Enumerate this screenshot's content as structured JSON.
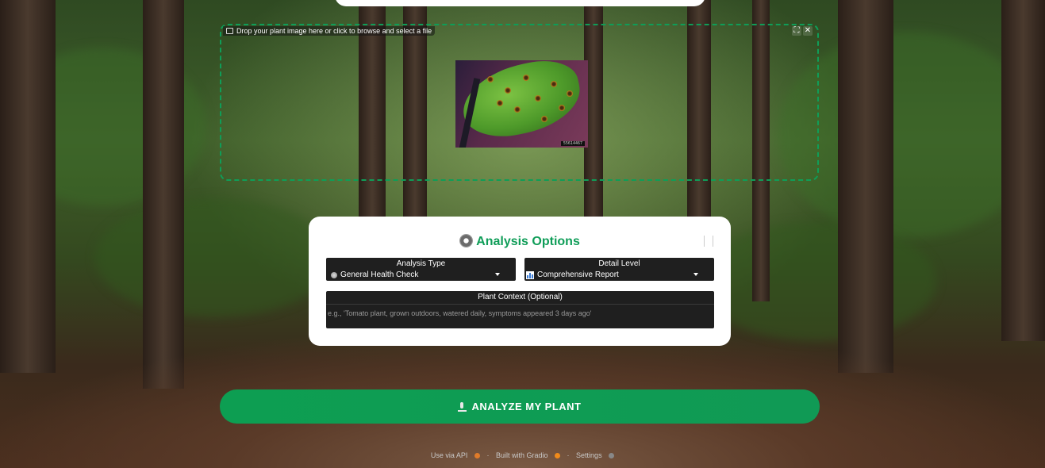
{
  "upload": {
    "label": "Drop your plant image here or click to browse and select a file",
    "image_tag": "55614467"
  },
  "options": {
    "title": "Analysis Options",
    "analysis_type": {
      "label": "Analysis Type",
      "value": "General Health Check"
    },
    "detail_level": {
      "label": "Detail Level",
      "value": "Comprehensive Report"
    },
    "context": {
      "label": "Plant Context (Optional)",
      "placeholder": "e.g., 'Tomato plant, grown outdoors, watered daily, symptoms appeared 3 days ago'"
    }
  },
  "analyze_button": {
    "label": "ANALYZE MY PLANT"
  },
  "footer": {
    "api": "Use via API",
    "built": "Built with Gradio",
    "settings": "Settings"
  },
  "colors": {
    "accent": "#0f9d58"
  }
}
